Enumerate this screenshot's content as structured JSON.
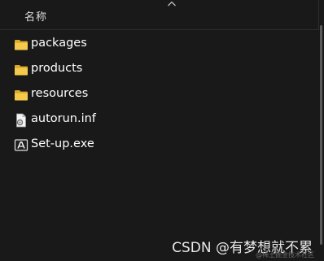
{
  "header": {
    "column_name_label": "名称"
  },
  "files": [
    {
      "name": "packages",
      "icon": "folder-icon",
      "type": "folder"
    },
    {
      "name": "products",
      "icon": "folder-icon",
      "type": "folder"
    },
    {
      "name": "resources",
      "icon": "folder-icon",
      "type": "folder"
    },
    {
      "name": "autorun.inf",
      "icon": "settings-file-icon",
      "type": "file"
    },
    {
      "name": "Set-up.exe",
      "icon": "adobe-app-icon",
      "type": "file"
    }
  ],
  "watermark": {
    "text": "CSDN @有梦想就不累",
    "subtext": "@稀土掘金技术社区"
  },
  "colors": {
    "background": "#191919",
    "folder": "#f2c84b",
    "text": "#ffffff"
  }
}
